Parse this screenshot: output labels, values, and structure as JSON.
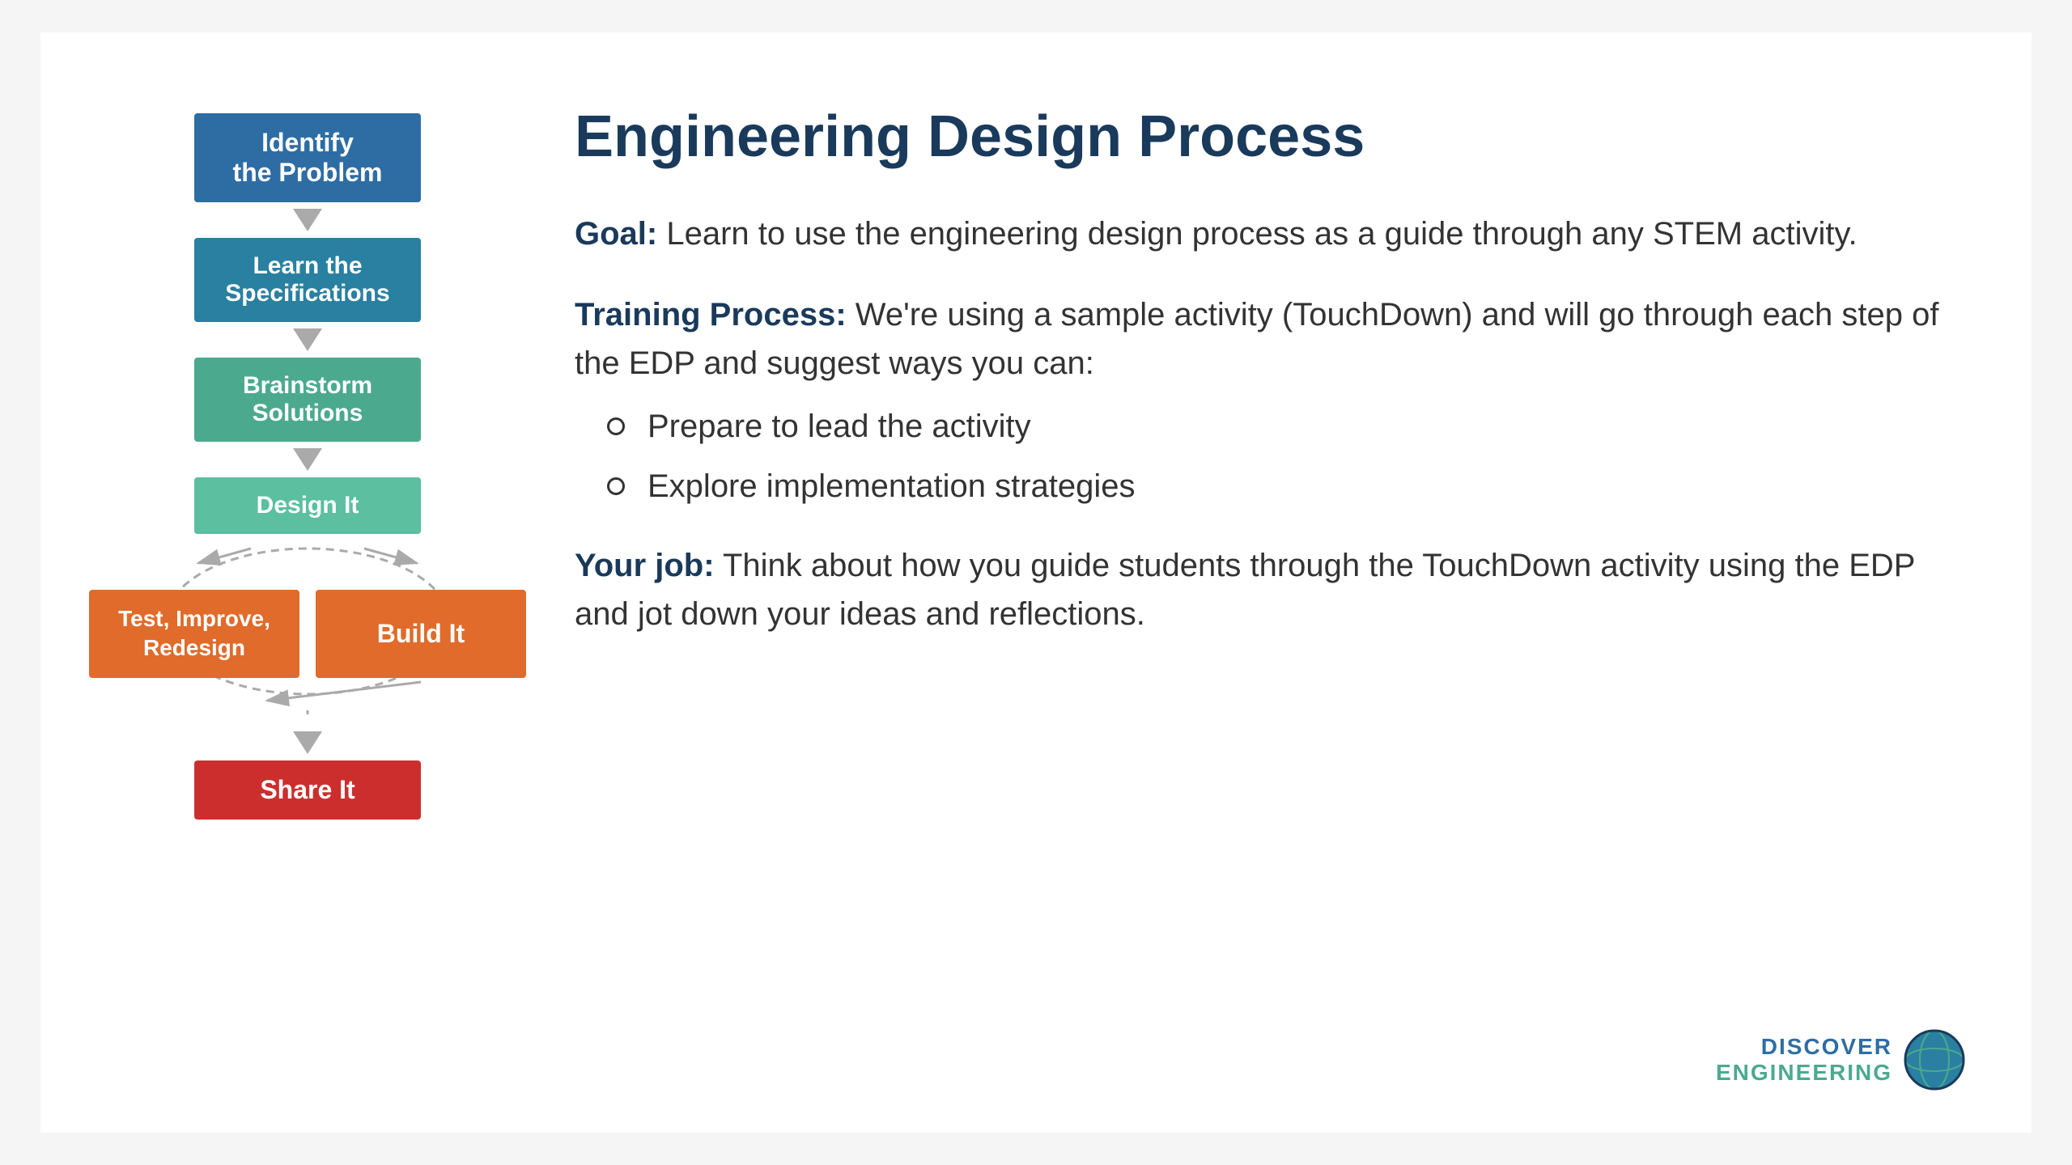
{
  "slide": {
    "title": "Engineering Design Process",
    "flowchart": {
      "steps": [
        {
          "id": "identify",
          "label": "Identify\nthe Problem",
          "color": "#2e6da4"
        },
        {
          "id": "learn",
          "label": "Learn the\nSpecifications",
          "color": "#2980a0"
        },
        {
          "id": "brainstorm",
          "label": "Brainstorm\nSolutions",
          "color": "#4baa8e"
        },
        {
          "id": "design",
          "label": "Design It",
          "color": "#5bbfa0"
        },
        {
          "id": "test",
          "label": "Test, Improve,\nRedesign",
          "color": "#e06b2a"
        },
        {
          "id": "build",
          "label": "Build It",
          "color": "#e06b2a"
        },
        {
          "id": "share",
          "label": "Share It",
          "color": "#cc2e2e"
        }
      ]
    },
    "content": {
      "goal_label": "Goal:",
      "goal_text": " Learn to use the engineering design process as a guide through any STEM activity.",
      "training_label": "Training Process:",
      "training_text": " We're using a sample activity (TouchDown) and will go through each step of the EDP and suggest ways you can:",
      "bullets": [
        "Prepare to lead the activity",
        "Explore implementation strategies"
      ],
      "yourjob_label": "Your job:",
      "yourjob_text": " Think about how you guide students through the TouchDown activity using the EDP and jot down your ideas and  reflections."
    },
    "logo": {
      "text": "DISCOVER\nENGINEERING"
    }
  }
}
